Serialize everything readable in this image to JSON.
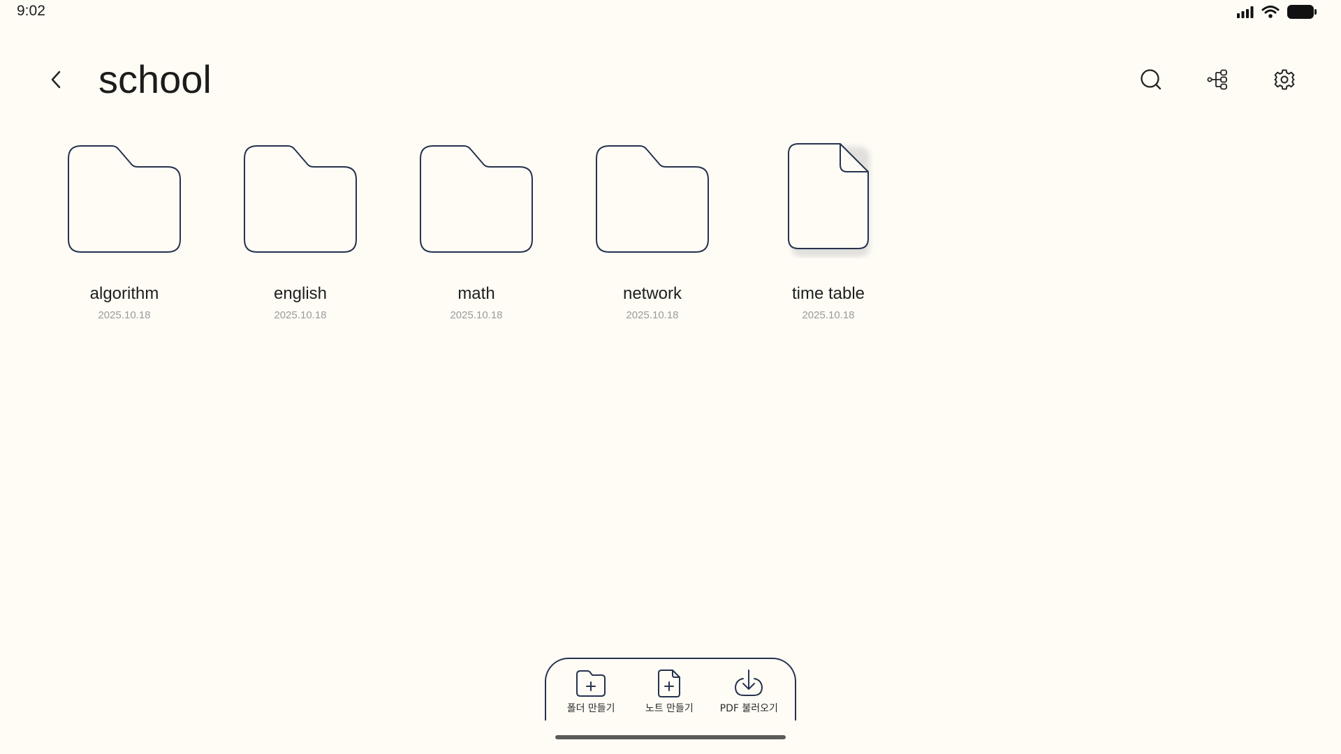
{
  "status_bar": {
    "time": "9:02"
  },
  "header": {
    "title": "school",
    "back_icon": "chevron-left-icon",
    "actions": [
      {
        "name": "search",
        "icon": "search-icon"
      },
      {
        "name": "share",
        "icon": "tree-structure-icon"
      },
      {
        "name": "settings",
        "icon": "gear-icon"
      }
    ]
  },
  "items": [
    {
      "type": "folder",
      "name": "algorithm",
      "date": "2025.10.18"
    },
    {
      "type": "folder",
      "name": "english",
      "date": "2025.10.18"
    },
    {
      "type": "folder",
      "name": "math",
      "date": "2025.10.18"
    },
    {
      "type": "folder",
      "name": "network",
      "date": "2025.10.18"
    },
    {
      "type": "note",
      "name": "time table",
      "date": "2025.10.18"
    }
  ],
  "bottom_bar": {
    "create_folder_label": "폴더 만들기",
    "create_note_label": "노트 만들기",
    "import_pdf_label": "PDF 불러오기"
  },
  "colors": {
    "background": "#fefcf5",
    "icon_stroke": "#26324f",
    "date_text": "#9b9b9b"
  }
}
